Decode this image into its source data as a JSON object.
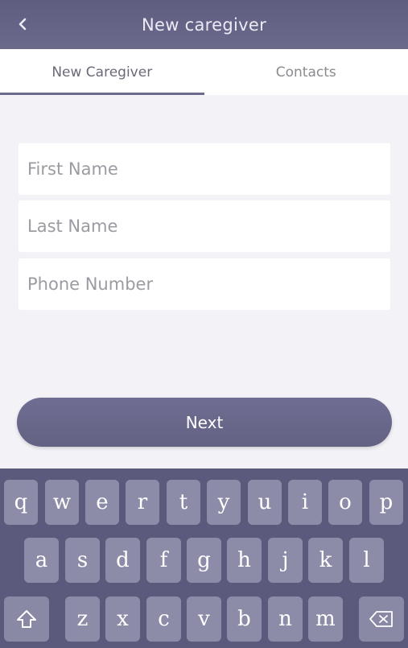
{
  "header": {
    "title": "New caregiver",
    "back_icon": "chevron-left-icon"
  },
  "tabs": [
    {
      "label": "New Caregiver",
      "active": true
    },
    {
      "label": "Contacts",
      "active": false
    }
  ],
  "form": {
    "first_name_placeholder": "First Name",
    "last_name_placeholder": "Last Name",
    "phone_placeholder": "Phone Number",
    "next_label": "Next"
  },
  "keyboard": {
    "row1": [
      "q",
      "w",
      "e",
      "r",
      "t",
      "y",
      "u",
      "i",
      "o",
      "p"
    ],
    "row2": [
      "a",
      "s",
      "d",
      "f",
      "g",
      "h",
      "j",
      "k",
      "l"
    ],
    "row3": [
      "z",
      "x",
      "c",
      "v",
      "b",
      "n",
      "m"
    ],
    "shift_icon": "shift-arrow-icon",
    "backspace_icon": "backspace-icon"
  },
  "colors": {
    "header_bg": "#5e5d80",
    "accent": "#6d6b8d",
    "keyboard_bg": "#5b5a7d",
    "key_bg": "#8d8ca8"
  }
}
